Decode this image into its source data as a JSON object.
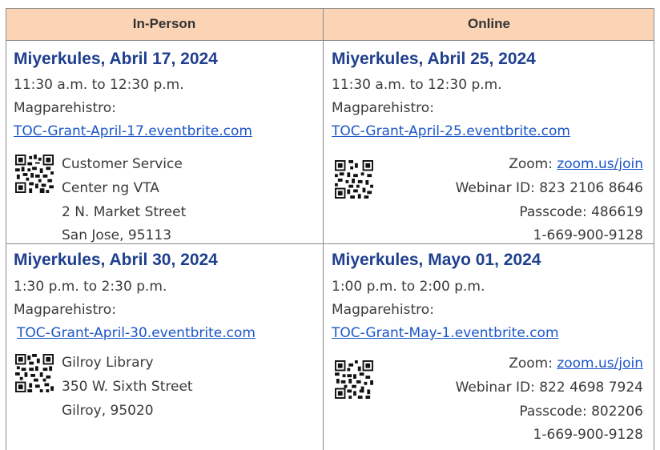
{
  "header": {
    "col1": "In-Person",
    "col2": "Online"
  },
  "sessions": [
    {
      "date": "Miyerkules, Abril 17, 2024",
      "time": "11:30 a.m. to 12:30 p.m.",
      "register_label": "Magparehistro:",
      "link": "TOC-Grant-April-17.eventbrite.com",
      "address": [
        "Customer Service",
        "Center ng VTA",
        "2 N. Market Street",
        "San Jose, 95113"
      ]
    },
    {
      "date": "Miyerkules, Abril 25, 2024",
      "time": "11:30 a.m. to 12:30 p.m.",
      "register_label": "Magparehistro:",
      "link": "TOC-Grant-April-25.eventbrite.com",
      "zoom_label": "Zoom: ",
      "zoom_link": "zoom.us/join",
      "webinar": "Webinar ID: 823 2106 8646",
      "passcode": "Passcode: 486619",
      "phone": "1-669-900-9128"
    },
    {
      "date": "Miyerkules, Abril 30, 2024",
      "time": "1:30 p.m. to 2:30 p.m.",
      "register_label": "Magparehistro:",
      "link": "TOC-Grant-April-30.eventbrite.com",
      "address": [
        "Gilroy Library",
        "350 W. Sixth Street",
        "Gilroy, 95020"
      ]
    },
    {
      "date": "Miyerkules, Mayo 01, 2024",
      "time": "1:00 p.m. to 2:00 p.m.",
      "register_label": "Magparehistro:",
      "link": "TOC-Grant-May-1.eventbrite.com",
      "zoom_label": "Zoom: ",
      "zoom_link": "zoom.us/join",
      "webinar": "Webinar ID: 822 4698 7924",
      "passcode": "Passcode: 802206",
      "phone": "1-669-900-9128"
    }
  ],
  "colors": {
    "header_bg": "#fbd4b5",
    "date": "#1f3f8f",
    "link": "#1a55c8",
    "border": "#8a8a8a"
  }
}
